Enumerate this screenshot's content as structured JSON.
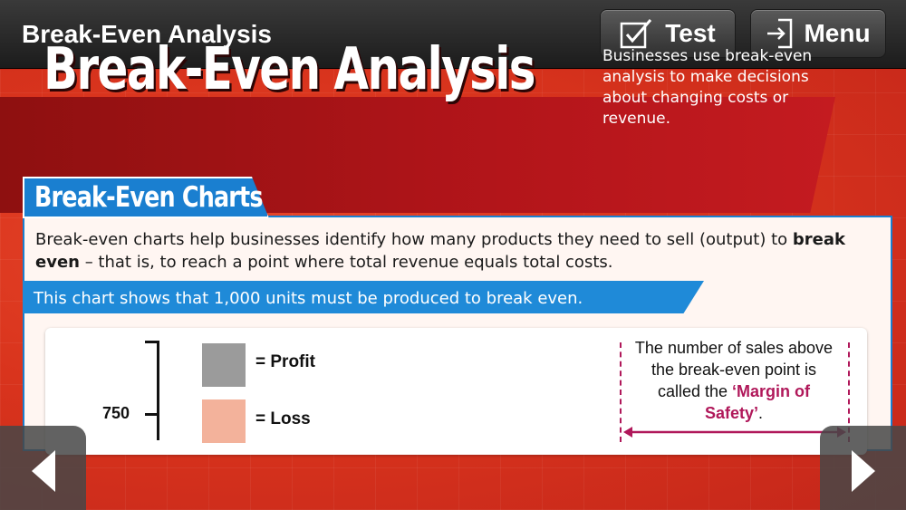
{
  "header": {
    "title": "Break-Even Analysis",
    "test_label": "Test",
    "menu_label": "Menu"
  },
  "banner": {
    "title": "Break-Even Analysis",
    "description": "Businesses use break-even analysis to make decisions about changing costs or revenue."
  },
  "section": {
    "heading": "Break-Even Charts",
    "intro_part1": "Break-even charts help businesses identify how many products they need to sell (output) to ",
    "intro_bold": "break even",
    "intro_part2": " – that is, to reach a point where total revenue equals total costs.",
    "chart_note": "This chart shows that 1,000 units must be produced to break even."
  },
  "chart": {
    "y_tick": "750",
    "legend": [
      {
        "label": "= Profit",
        "color": "#9b9b9b"
      },
      {
        "label": "= Loss",
        "color": "#f3b29b"
      }
    ],
    "margin_of_safety_text": "The number of sales above the break-even point is called the",
    "margin_of_safety_term": "‘Margin of Safety’",
    "margin_of_safety_end": "."
  },
  "navigation": {
    "prev_icon": "chevron-left-icon",
    "next_icon": "chevron-right-icon"
  },
  "colors": {
    "accent_blue": "#1a7fd0",
    "poster_red": "#d9341d",
    "banner_red": "#b3151a",
    "highlight": "#b0185a"
  }
}
